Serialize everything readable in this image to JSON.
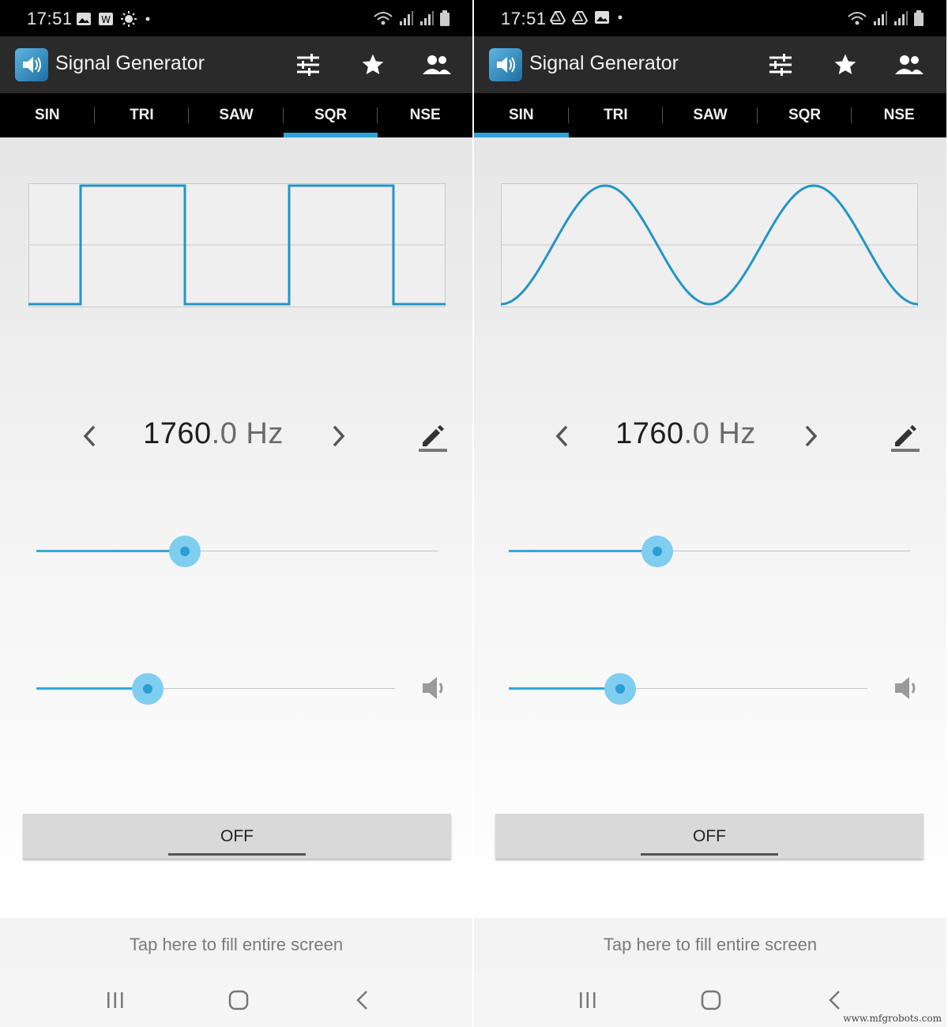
{
  "screens": [
    {
      "status": {
        "time": "17:51",
        "left_icons": [
          "gallery-icon",
          "w-badge-icon",
          "brightness-icon",
          "dot-icon"
        ]
      },
      "app": {
        "title": "Signal Generator"
      },
      "tabs": [
        {
          "label": "SIN",
          "active": false
        },
        {
          "label": "TRI",
          "active": false
        },
        {
          "label": "SAW",
          "active": false
        },
        {
          "label": "SQR",
          "active": true
        },
        {
          "label": "NSE",
          "active": false
        }
      ],
      "waveform": "square",
      "frequency": {
        "integer": "1760",
        "decimal": ".0 Hz"
      },
      "frequency_slider_fraction": 0.37,
      "volume_slider_fraction": 0.31,
      "power_button": "OFF",
      "fill_screen": "Tap here to fill entire screen"
    },
    {
      "status": {
        "time": "17:51",
        "left_icons": [
          "drive-icon",
          "drive-icon",
          "gallery-icon",
          "dot-icon"
        ]
      },
      "app": {
        "title": "Signal Generator"
      },
      "tabs": [
        {
          "label": "SIN",
          "active": true
        },
        {
          "label": "TRI",
          "active": false
        },
        {
          "label": "SAW",
          "active": false
        },
        {
          "label": "SQR",
          "active": false
        },
        {
          "label": "NSE",
          "active": false
        }
      ],
      "waveform": "sine",
      "frequency": {
        "integer": "1760",
        "decimal": ".0 Hz"
      },
      "frequency_slider_fraction": 0.37,
      "volume_slider_fraction": 0.31,
      "power_button": "OFF",
      "fill_screen": "Tap here to fill entire screen"
    }
  ],
  "colors": {
    "accent": "#2fa3d6",
    "toolbar": "#2a2a2a",
    "tabbar": "#000000"
  },
  "watermark": "www.mfgrobots.com"
}
